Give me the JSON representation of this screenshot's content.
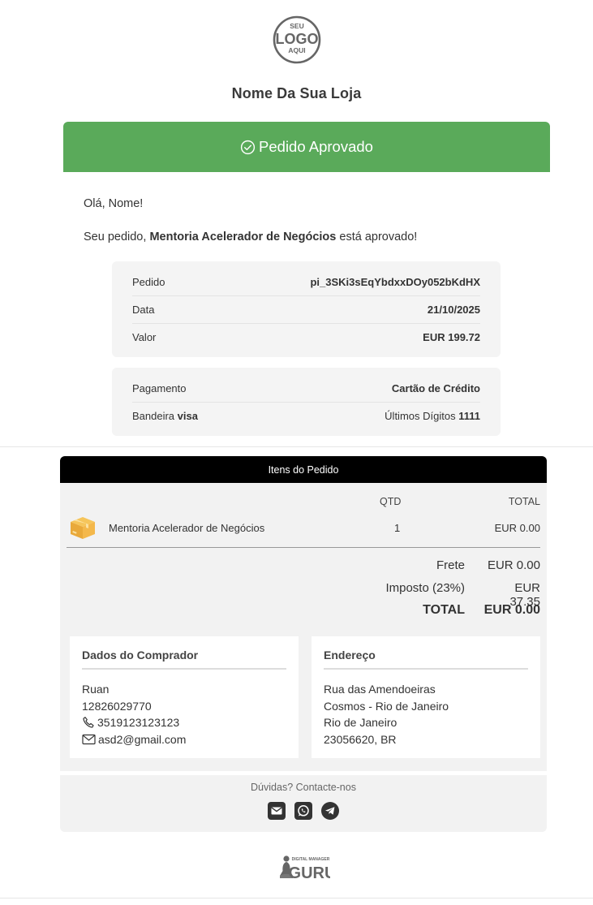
{
  "brand": {
    "logo_text": [
      "SEU",
      "LOGO",
      "AQUI"
    ],
    "store_name": "Nome Da Sua Loja",
    "accent_color": "#5aaa5a"
  },
  "status": {
    "label": "Pedido Aprovado",
    "icon": "check-circle-icon"
  },
  "message": {
    "greeting": "Olá, Nome!",
    "prefix": "Seu pedido,",
    "product": "Mentoria Acelerador de Negócios",
    "suffix": "está aprovado!"
  },
  "order_info": [
    {
      "label": "Pedido",
      "value": "pi_3SKi3sEqYbdxxDOy052bKdHX"
    },
    {
      "label": "Data",
      "value": "21/10/2025"
    },
    {
      "label": "Valor",
      "value": "EUR 199.72"
    }
  ],
  "payment": {
    "method_label": "Pagamento",
    "method_value": "Cartão de Crédito",
    "brand_label": "Bandeira",
    "brand_value": "visa",
    "digits_label": "Últimos Dígitos",
    "digits_value": "1111"
  },
  "items": {
    "header": "Itens do Pedido",
    "col_qty": "QTD",
    "col_total": "TOTAL",
    "rows": [
      {
        "name": "Mentoria Acelerador de Negócios",
        "qty": "1",
        "total": "EUR 0.00",
        "icon": "package-box-icon"
      }
    ],
    "summary": {
      "shipping_label": "Frete",
      "shipping_value": "EUR 0.00",
      "tax_label": "Imposto (23%)",
      "tax_value": "EUR 37.35",
      "total_label": "TOTAL",
      "total_value": "EUR 0.00"
    }
  },
  "buyer": {
    "title": "Dados do Comprador",
    "name": "Ruan",
    "document": "12826029770",
    "phone": "3519123123123",
    "email": "asd2@gmail.com"
  },
  "address": {
    "title": "Endereço",
    "line1": "Rua das Amendoeiras",
    "line2": "Cosmos - Rio de Janeiro",
    "line3": "Rio de Janeiro",
    "line4": "23056620, BR"
  },
  "contact": {
    "text": "Dúvidas? Contacte-nos",
    "icons": [
      "email-icon",
      "whatsapp-icon",
      "telegram-icon"
    ]
  },
  "footer": {
    "brand_small": "DIGITAL MANAGER",
    "brand_big": "GURU"
  }
}
